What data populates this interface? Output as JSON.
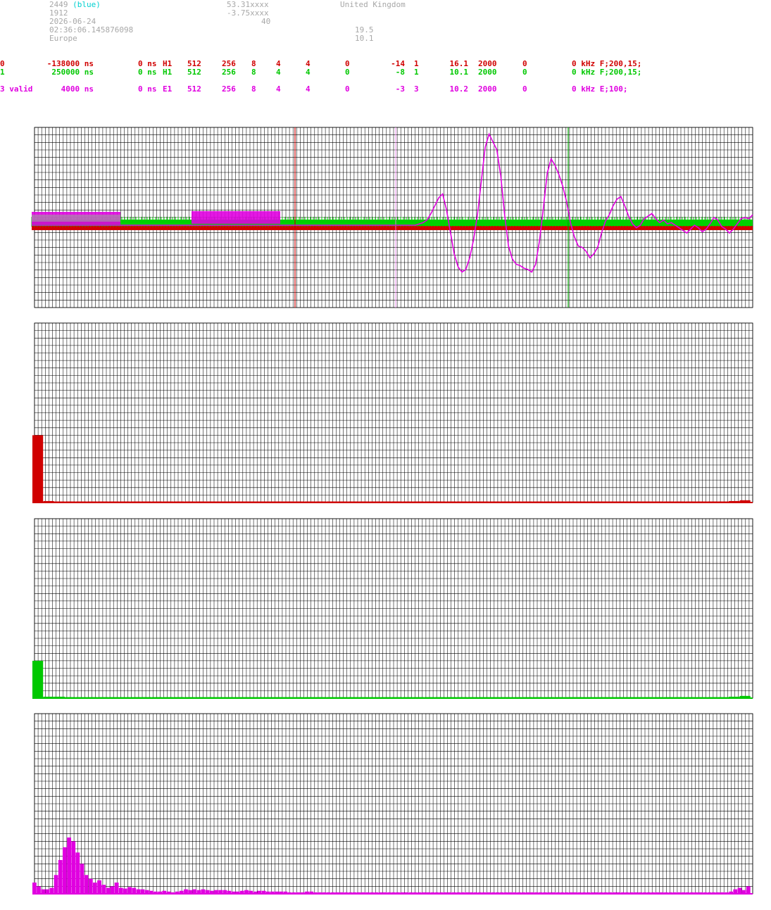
{
  "header": {
    "station_id": "2449",
    "station_tag": "(blue)",
    "lat": "53.31xxxx",
    "country": "United Kingdom",
    "code": "1912",
    "lon": "-3.75xxxx",
    "date": "2026-06-24",
    "alt": "40",
    "time": "02:36:06.145876098",
    "val1": "19.5",
    "region": "Europe",
    "val2": "10.1"
  },
  "channels": [
    {
      "id": "0",
      "offset": "-138000 ns",
      "delay": "0 ns",
      "type": "H1",
      "n1": "512",
      "n2": "256",
      "n3": "8",
      "n4": "4",
      "n5": "4",
      "n6": "0",
      "gain": "-14",
      "n7": "1",
      "snr": "16.1",
      "rate": "2000",
      "n8": "0",
      "filter": "0 kHz F;200,15;",
      "color": "#d00000"
    },
    {
      "id": "1",
      "offset": "250000 ns",
      "delay": "0 ns",
      "type": "H1",
      "n1": "512",
      "n2": "256",
      "n3": "8",
      "n4": "4",
      "n5": "4",
      "n6": "0",
      "gain": "-8",
      "n7": "1",
      "snr": "10.1",
      "rate": "2000",
      "n8": "0",
      "filter": "0 kHz F;200,15;",
      "color": "#00c800"
    },
    {
      "id": "3 valid",
      "offset": "4000 ns",
      "delay": "0 ns",
      "type": "E1",
      "n1": "512",
      "n2": "256",
      "n3": "8",
      "n4": "4",
      "n5": "4",
      "n6": "0",
      "gain": "-3",
      "n7": "3",
      "snr": "10.2",
      "rate": "2000",
      "n8": "0",
      "filter": "0 kHz E;100;",
      "color": "#e000e0"
    }
  ],
  "chart_data": [
    {
      "type": "line",
      "series": [
        {
          "color": "#e000e0",
          "values": [
            0,
            0,
            0,
            0,
            0,
            0,
            0,
            0,
            0,
            0,
            0,
            0,
            0,
            0,
            0,
            0,
            0,
            0,
            0,
            0,
            0,
            0,
            0,
            0,
            0,
            0,
            0,
            0,
            0,
            0,
            0,
            0,
            0,
            0,
            0,
            0,
            0,
            0,
            0,
            0,
            0,
            0,
            0,
            0,
            0,
            0,
            0,
            0,
            0,
            0,
            0,
            0,
            0,
            0,
            0,
            0,
            0,
            0,
            0,
            0,
            0,
            0,
            0,
            0,
            0,
            0,
            0,
            0,
            0,
            0,
            0,
            0,
            0,
            0,
            0,
            0,
            0,
            0,
            0,
            0,
            0,
            0,
            0,
            0,
            0,
            0,
            0,
            0,
            0,
            0,
            0,
            0,
            0,
            0,
            0,
            0,
            0,
            0,
            0,
            0,
            0.1,
            0.2,
            0.4,
            0.9,
            1.5,
            2.1,
            2.4,
            1.2,
            -0.5,
            -2.2,
            -3.2,
            -3.6,
            -3.4,
            -2.5,
            -1.1,
            0.8,
            3.4,
            6.0,
            7.0,
            6.4,
            5.8,
            3.8,
            0.8,
            -1.6,
            -2.6,
            -3.0,
            -3.1,
            -3.3,
            -3.4,
            -3.6,
            -3.0,
            -1.2,
            1.3,
            4.0,
            5.1,
            4.6,
            3.9,
            3.0,
            1.8,
            0.2,
            -0.9,
            -1.6,
            -1.7,
            -2.0,
            -2.5,
            -2.2,
            -1.7,
            -0.6,
            0.3,
            0.8,
            1.5,
            2.0,
            2.2,
            1.5,
            0.7,
            0.1,
            -0.2,
            0.0,
            0.5,
            0.7,
            0.9,
            0.5,
            0.2,
            0.4,
            0.1,
            0.2,
            0.0,
            -0.2,
            -0.4,
            -0.6,
            -0.3,
            0.0,
            -0.2,
            -0.5,
            -0.3,
            0.1,
            0.6,
            0.4,
            -0.1,
            -0.3,
            -0.6,
            -0.3,
            0.1,
            0.5,
            0.6,
            0.5,
            0.8
          ]
        },
        {
          "color": "#00c800",
          "values": []
        },
        {
          "color": "#d00000",
          "values": []
        }
      ]
    },
    {
      "type": "bar",
      "color": "#d00000",
      "values": [
        9.0,
        0.2,
        0.1,
        0.1,
        0.1,
        0.1,
        0.1,
        0.1,
        0.1,
        0.1,
        0.1,
        0.1,
        0.1,
        0.1,
        0.1,
        0.1,
        0.1,
        0.1,
        0.1,
        0.1,
        0.1,
        0.1,
        0.1,
        0.1,
        0.1,
        0.1,
        0.1,
        0.1,
        0.1,
        0.1,
        0.1,
        0.1,
        0.1,
        0.1,
        0.1,
        0.1,
        0.1,
        0.1,
        0.1,
        0.1,
        0.1,
        0.1,
        0.1,
        0.1,
        0.1,
        0.1,
        0.1,
        0.1,
        0.1,
        0.1,
        0.1,
        0.1,
        0.1,
        0.1,
        0.1,
        0.1,
        0.1,
        0.1,
        0.1,
        0.1,
        0.1,
        0.1,
        0.1,
        0.1,
        0.2,
        0.3
      ]
    },
    {
      "type": "bar",
      "color": "#00c800",
      "values": [
        5.0,
        0.2,
        0.2,
        0.1,
        0.1,
        0.1,
        0.1,
        0.1,
        0.1,
        0.1,
        0.1,
        0.1,
        0.1,
        0.1,
        0.1,
        0.1,
        0.1,
        0.1,
        0.1,
        0.1,
        0.1,
        0.1,
        0.1,
        0.1,
        0.1,
        0.1,
        0.1,
        0.1,
        0.1,
        0.1,
        0.1,
        0.1,
        0.1,
        0.1,
        0.1,
        0.1,
        0.1,
        0.1,
        0.1,
        0.1,
        0.1,
        0.1,
        0.1,
        0.1,
        0.1,
        0.1,
        0.1,
        0.1,
        0.1,
        0.1,
        0.1,
        0.1,
        0.1,
        0.1,
        0.1,
        0.1,
        0.1,
        0.1,
        0.1,
        0.1,
        0.1,
        0.1,
        0.1,
        0.1,
        0.2,
        0.3
      ]
    },
    {
      "type": "bar",
      "color": "#e000e0",
      "values": [
        1.5,
        1.0,
        0.6,
        0.6,
        0.8,
        2.5,
        4.5,
        6.2,
        7.5,
        7.0,
        5.5,
        4.0,
        2.5,
        2.0,
        1.5,
        1.8,
        1.2,
        0.8,
        1.0,
        1.5,
        0.8,
        0.7,
        0.9,
        0.8,
        0.6,
        0.6,
        0.5,
        0.4,
        0.3,
        0.3,
        0.4,
        0.3,
        0.2,
        0.3,
        0.4,
        0.6,
        0.5,
        0.6,
        0.5,
        0.6,
        0.5,
        0.4,
        0.5,
        0.5,
        0.5,
        0.4,
        0.3,
        0.3,
        0.4,
        0.5,
        0.4,
        0.3,
        0.4,
        0.4,
        0.3,
        0.3,
        0.3,
        0.3,
        0.3,
        0.2,
        0.2,
        0.2,
        0.2,
        0.3,
        0.3,
        0.2,
        0.2,
        0.2,
        0.2,
        0.2,
        0.2,
        0.2,
        0.2,
        0.2,
        0.2,
        0.2,
        0.2,
        0.2,
        0.2,
        0.2,
        0.2,
        0.2,
        0.2,
        0.2,
        0.2,
        0.2,
        0.2,
        0.2,
        0.2,
        0.2,
        0.2,
        0.2,
        0.2,
        0.2,
        0.2,
        0.2,
        0.2,
        0.2,
        0.2,
        0.2,
        0.2,
        0.2,
        0.2,
        0.2,
        0.2,
        0.2,
        0.2,
        0.2,
        0.2,
        0.2,
        0.2,
        0.2,
        0.2,
        0.2,
        0.2,
        0.2,
        0.2,
        0.2,
        0.2,
        0.2,
        0.2,
        0.2,
        0.2,
        0.2,
        0.2,
        0.2,
        0.2,
        0.2,
        0.2,
        0.2,
        0.2,
        0.2,
        0.2,
        0.2,
        0.2,
        0.2,
        0.2,
        0.2,
        0.2,
        0.2,
        0.2,
        0.2,
        0.2,
        0.2,
        0.2,
        0.2,
        0.2,
        0.2,
        0.2,
        0.2,
        0.2,
        0.2,
        0.2,
        0.2,
        0.2,
        0.2,
        0.2,
        0.2,
        0.2,
        0.2,
        0.2,
        0.3,
        0.6,
        0.8,
        0.5,
        1.0
      ]
    }
  ]
}
